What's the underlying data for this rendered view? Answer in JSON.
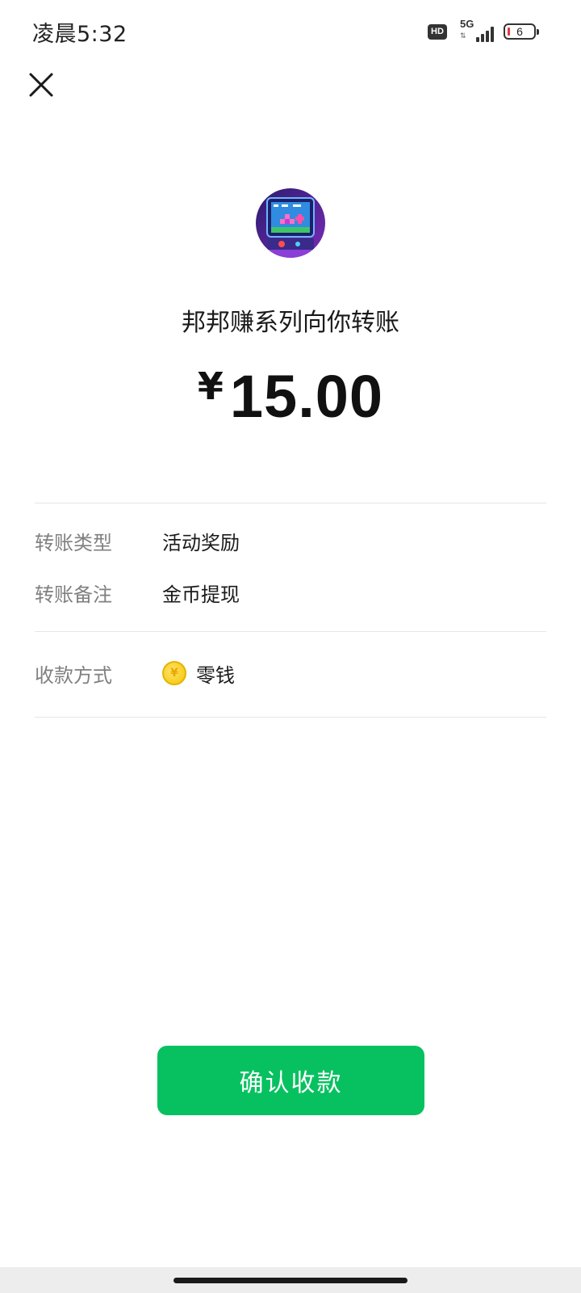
{
  "status_bar": {
    "time": "凌晨5:32",
    "hd_label": "HD",
    "network_label": "5G",
    "battery_level": "6"
  },
  "transfer": {
    "title": "邦邦赚系列向你转账",
    "currency_symbol": "¥",
    "amount": "15.00"
  },
  "details": [
    {
      "label": "转账类型",
      "value": "活动奖励"
    },
    {
      "label": "转账备注",
      "value": "金币提现"
    }
  ],
  "payment_method": {
    "label": "收款方式",
    "value": "零钱",
    "icon": "coin-yen-icon",
    "icon_glyph": "¥"
  },
  "actions": {
    "confirm_label": "确认收款"
  },
  "colors": {
    "accent": "#07c160",
    "label_gray": "#808080",
    "coin_yellow": "#f5c400"
  }
}
